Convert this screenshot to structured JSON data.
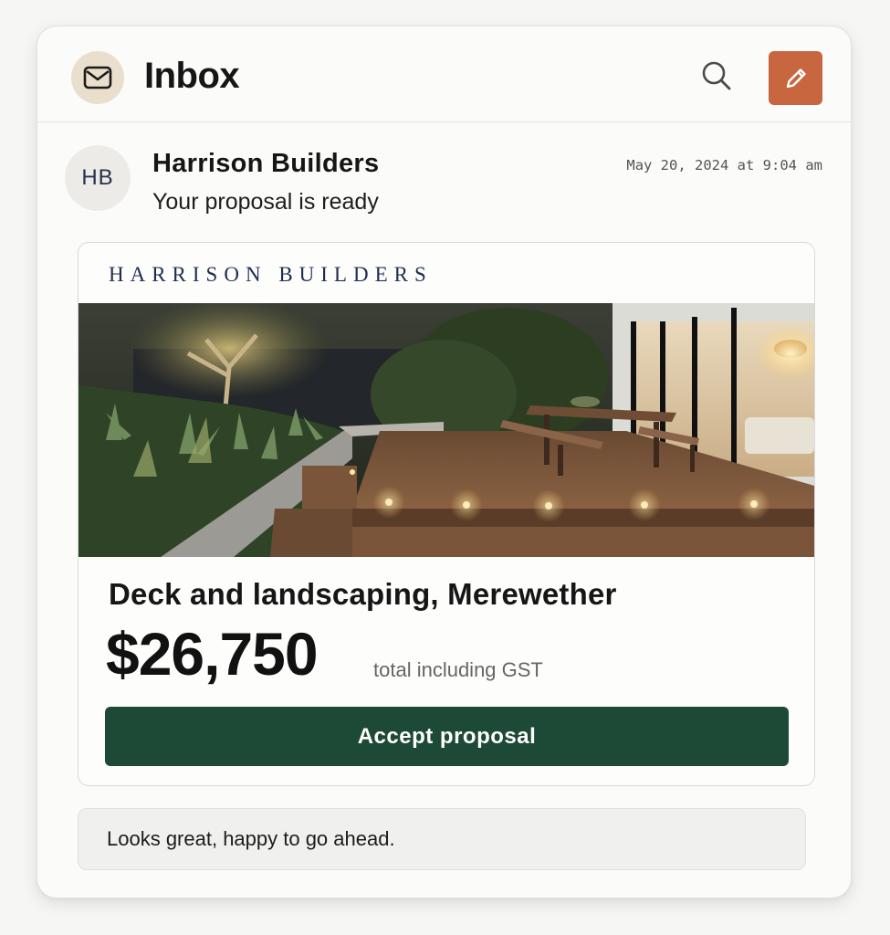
{
  "header": {
    "title": "Inbox",
    "icons": {
      "mail": "envelope-icon",
      "search": "search-icon",
      "compose": "pencil-icon"
    },
    "compose_color": "#c8673f"
  },
  "message": {
    "avatar_initials": "HB",
    "sender": "Harrison Builders",
    "timestamp": "May 20, 2024 at 9:04 am",
    "subject": "Your proposal is ready"
  },
  "proposal": {
    "brand": "HARRISON BUILDERS",
    "job_title": "Deck and landscaping, Merewether",
    "price": "$26,750",
    "price_note": "total including GST",
    "accept_label": "Accept proposal",
    "accept_color": "#1d4a36"
  },
  "reply": {
    "text": "Looks great, happy to go ahead."
  }
}
